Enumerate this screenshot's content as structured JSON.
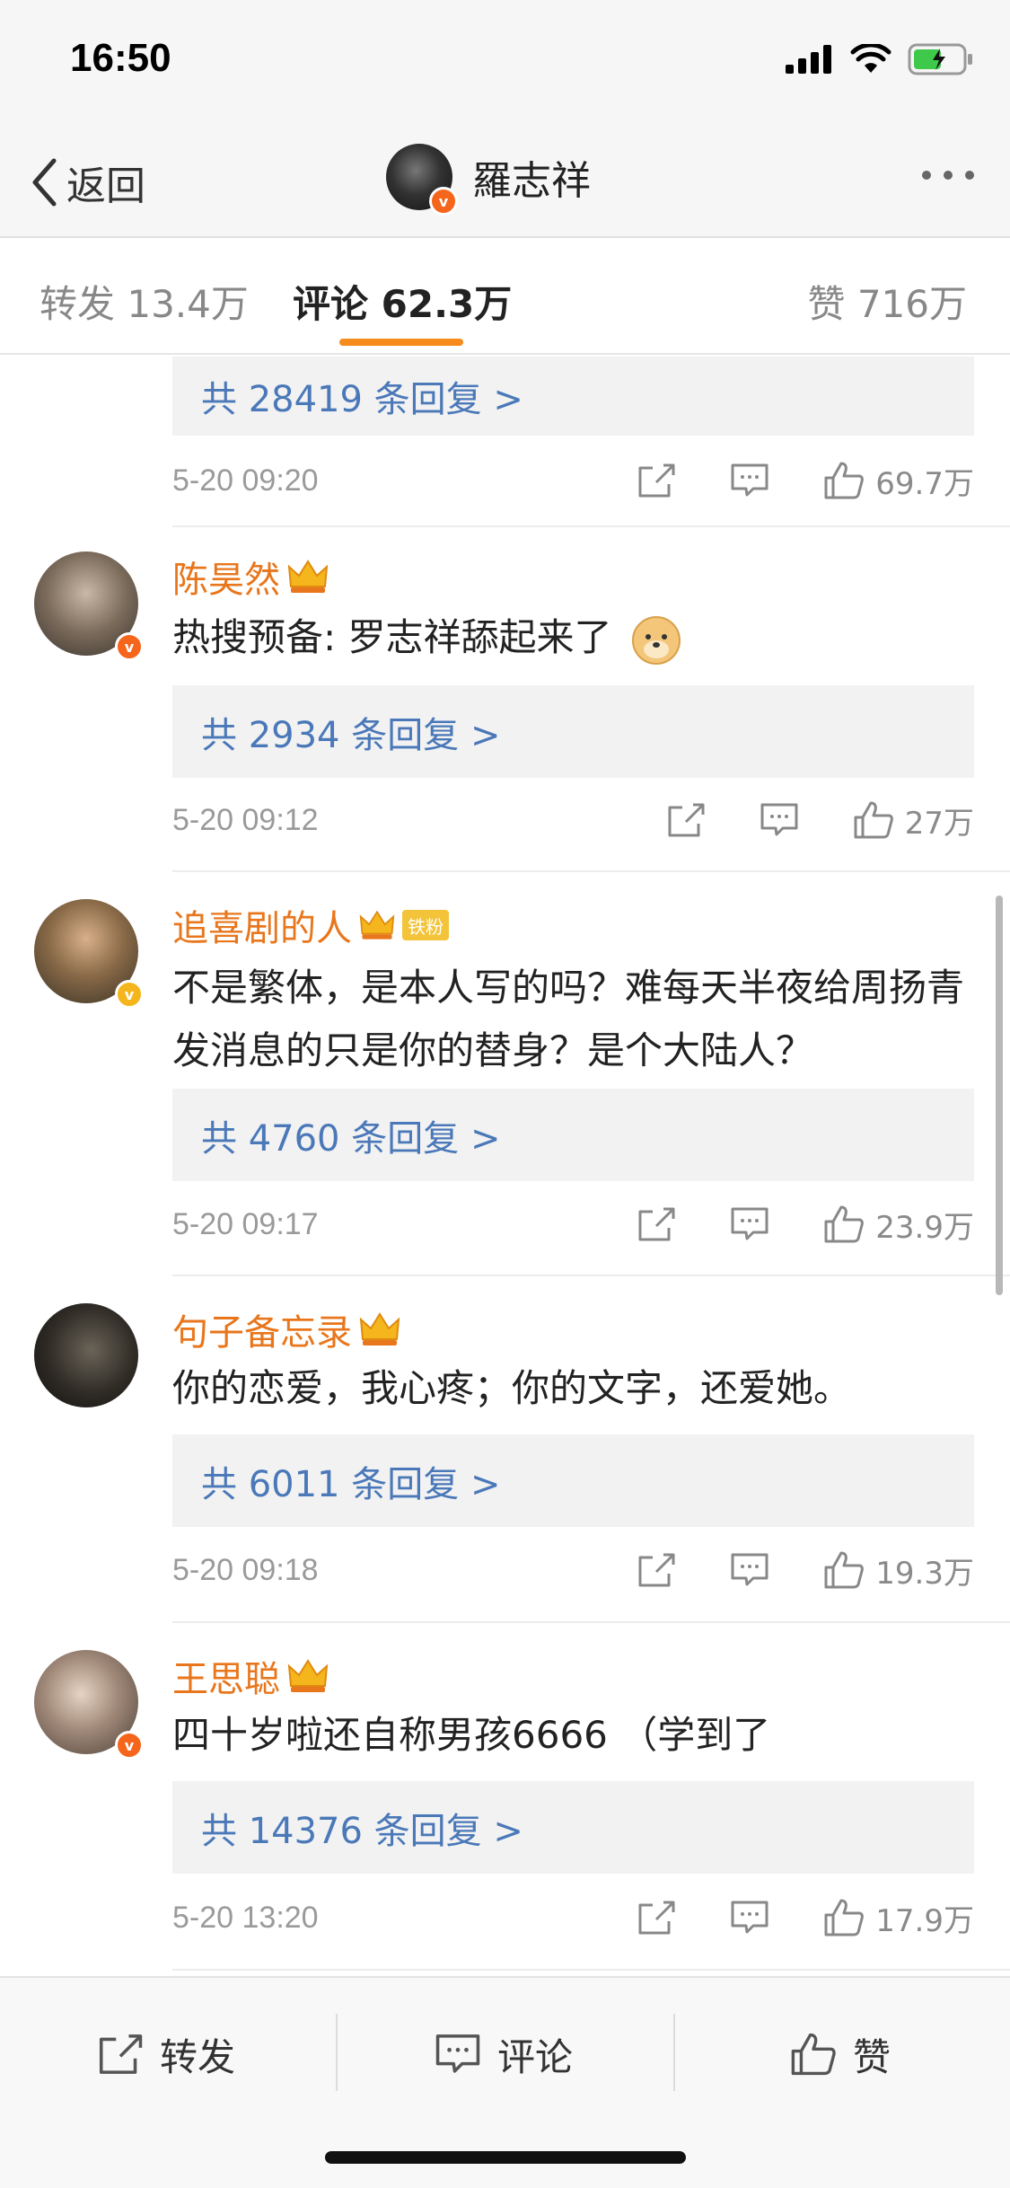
{
  "status_bar": {
    "time": "16:50"
  },
  "nav": {
    "back_label": "返回",
    "title": "羅志祥"
  },
  "tabs": [
    {
      "label": "转发 13.4万"
    },
    {
      "label": "评论 62.3万"
    },
    {
      "label": "赞 716万"
    }
  ],
  "top_partial": {
    "reply_summary": "共 28419 条回复 >",
    "time": "5-20 09:20",
    "likes": "69.7万"
  },
  "comments": [
    {
      "user": "陈昊然",
      "text": "热搜预备: 罗志祥舔起来了",
      "reply_summary": "共 2934 条回复 >",
      "time": "5-20 09:12",
      "likes": "27万"
    },
    {
      "user": "追喜剧的人",
      "fan_tag": "铁粉",
      "text": "不是繁体，是本人写的吗？难每天半夜给周扬青发消息的只是你的替身？是个大陆人？",
      "reply_summary": "共 4760 条回复 >",
      "time": "5-20 09:17",
      "likes": "23.9万"
    },
    {
      "user": "句子备忘录",
      "text": "你的恋爱，我心疼；你的文字，还爱她。",
      "reply_summary": "共 6011 条回复 >",
      "time": "5-20 09:18",
      "likes": "19.3万"
    },
    {
      "user": "王思聪",
      "text": "四十岁啦还自称男孩6666 （学到了",
      "reply_summary": "共 14376 条回复 >",
      "time": "5-20 13:20",
      "likes": "17.9万"
    }
  ],
  "bottom_bar": {
    "repost_label": "转发",
    "comment_label": "评论",
    "like_label": "赞"
  },
  "colors": {
    "accent_orange": "#f58c1c",
    "username": "#e8761c",
    "link_blue": "#4a78b8"
  },
  "icons": [
    "signal-icon",
    "wifi-icon",
    "battery-icon",
    "back-chevron-icon",
    "more-icon",
    "share-icon",
    "comment-icon",
    "like-icon",
    "crown-icon",
    "v-badge-icon",
    "doge-emoji-icon"
  ]
}
